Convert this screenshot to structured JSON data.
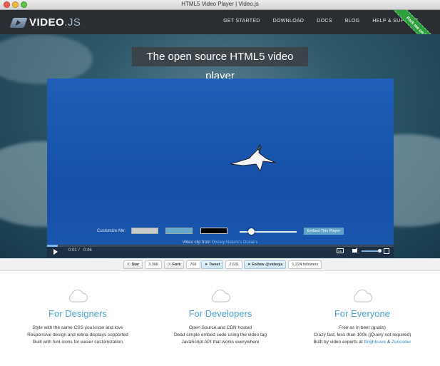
{
  "window": {
    "title": "HTML5 Video Player | Video.js"
  },
  "nav": {
    "logo_main": "VIDEO",
    "logo_suffix": ".JS",
    "links": [
      "GET STARTED",
      "DOWNLOAD",
      "DOCS",
      "BLOG",
      "HELP & SUPPORT"
    ],
    "ribbon": "Fork me on GitHub"
  },
  "hero": {
    "headline": "The open source HTML5 video player",
    "player": {
      "current_time": "0:01",
      "separator": "/",
      "duration": "0:46",
      "progress_fraction": 0.03,
      "volume_fraction": 0.85
    },
    "customize": {
      "label": "Customize Me:",
      "swatch_colors": [
        "#cccccc",
        "#66a8cc",
        "#000000"
      ],
      "embed_button": "Embed This Player"
    },
    "credit_prefix": "Video clip from",
    "credit_link": "Disney Nature's Oceans"
  },
  "social": {
    "star_label": "Star",
    "star_count": "3,366",
    "fork_label": "Fork",
    "fork_count": "766",
    "tweet_label": "Tweet",
    "tweet_count": "2,631",
    "follow_label": "Follow @videojs",
    "followers": "1,224 followers"
  },
  "features": [
    {
      "title": "For Designers",
      "lines": [
        "Style with the same CSS you know and love",
        "Responsive design and retina displays supported",
        "Built with font icons for easier customization"
      ]
    },
    {
      "title": "For Developers",
      "lines": [
        "Open Source and CDN hosted",
        "Dead simple embed code using the video tag",
        "JavaScript API that works everywhere"
      ]
    },
    {
      "title": "For Everyone",
      "lines": [
        "Free as in beer (gratis)",
        "Crazy fast, less than 100k (jQuery not required)"
      ],
      "last_prefix": "Built by video experts at",
      "link1": "Brightcove",
      "amp": "&",
      "link2": "Zencoder"
    }
  ],
  "colors": {
    "nav_bg": "#2b2e33",
    "accent_blue": "#4aa3d8",
    "ribbon_green": "#2f9e3f",
    "player_blue": "#1550a8"
  }
}
